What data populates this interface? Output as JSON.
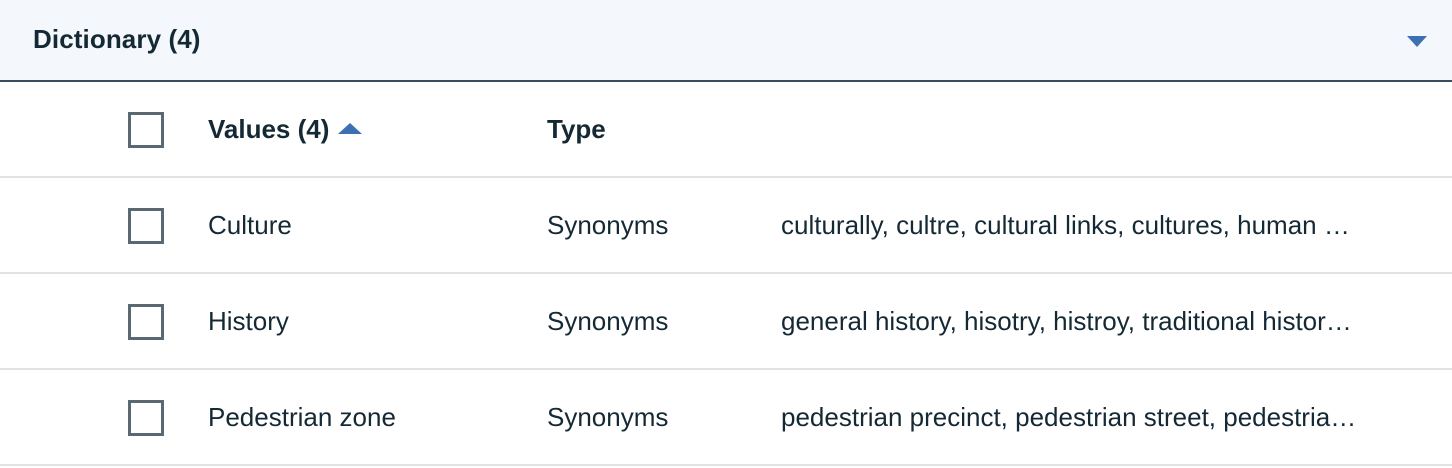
{
  "accordion": {
    "title": "Dictionary (4)"
  },
  "table": {
    "columns": {
      "values": "Values (4)",
      "type": "Type"
    },
    "rows": [
      {
        "value": "Culture",
        "type": "Synonyms",
        "detail": "culturally, cultre, cultural links, cultures, human …"
      },
      {
        "value": "History",
        "type": "Synonyms",
        "detail": "general history, hisotry, histroy, traditional histor…"
      },
      {
        "value": "Pedestrian zone",
        "type": "Synonyms",
        "detail": "pedestrian precinct, pedestrian street, pedestria…"
      }
    ]
  },
  "colors": {
    "accent": "#3d70b2",
    "text": "#152935",
    "header_bg": "#f4f7fb",
    "divider": "#dfe3e6"
  },
  "icons": {
    "collapse": "chevron-down-icon",
    "sort": "sort-ascending-icon"
  }
}
